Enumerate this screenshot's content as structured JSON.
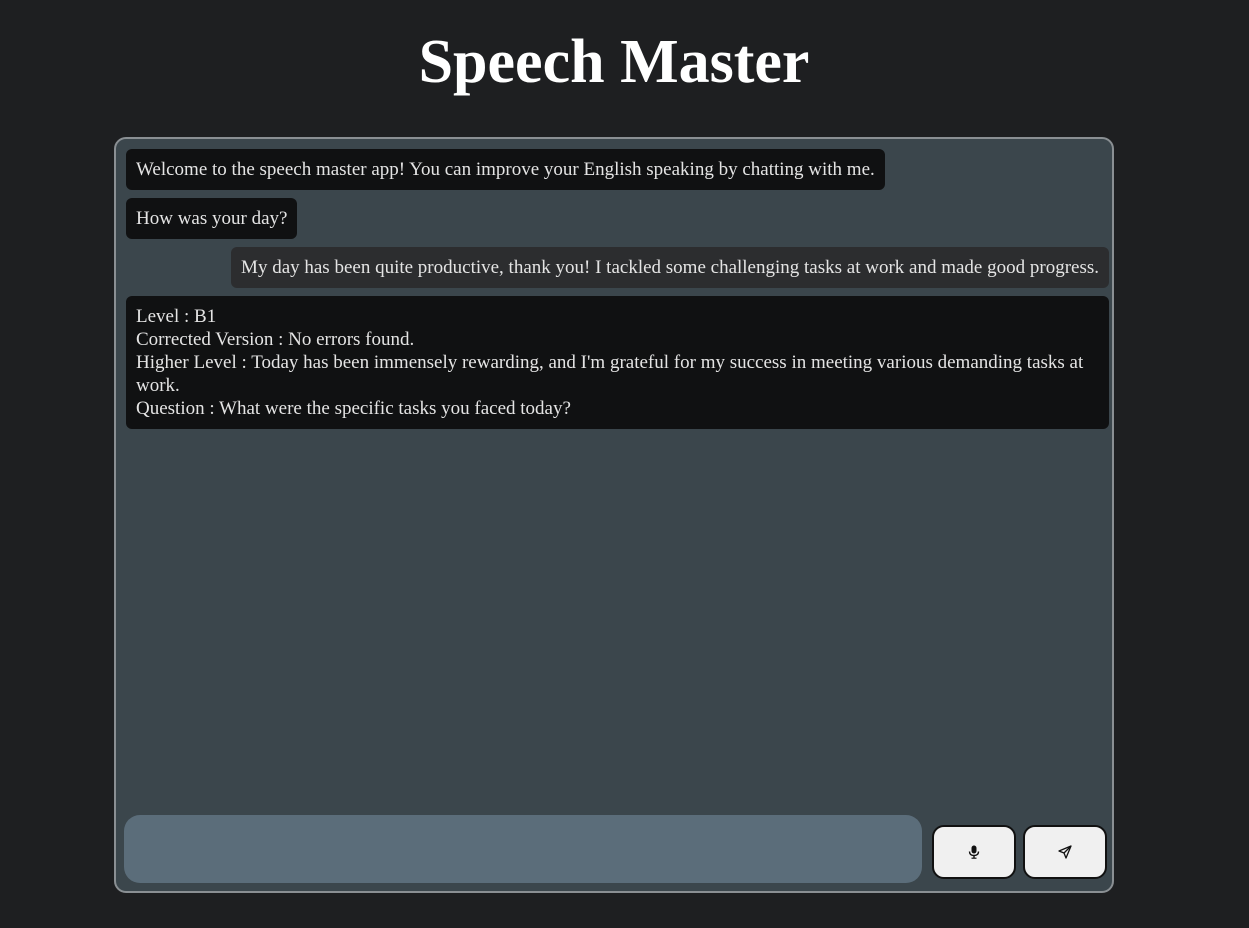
{
  "app": {
    "title": "Speech Master"
  },
  "messages": [
    {
      "role": "bot",
      "lines": [
        "Welcome to the speech master app! You can improve your English speaking by chatting with me."
      ]
    },
    {
      "role": "bot",
      "lines": [
        "How was your day?"
      ]
    },
    {
      "role": "user",
      "lines": [
        "My day has been quite productive, thank you! I tackled some challenging tasks at work and made good progress."
      ]
    },
    {
      "role": "bot",
      "lines": [
        "Level : B1",
        "Corrected Version : No errors found.",
        "Higher Level : Today has been immensely rewarding, and I'm grateful for my success in meeting various demanding tasks at work.",
        "Question : What were the specific tasks you faced today?"
      ]
    }
  ],
  "input": {
    "value": "",
    "placeholder": ""
  },
  "buttons": {
    "mic_icon": "microphone-icon",
    "send_icon": "send-icon"
  },
  "colors": {
    "page_background": "#1e1f21",
    "panel_background": "#3b464c",
    "bot_bubble": "#101112",
    "user_bubble": "#2c2d2f",
    "input_background": "#5b6d7a"
  }
}
